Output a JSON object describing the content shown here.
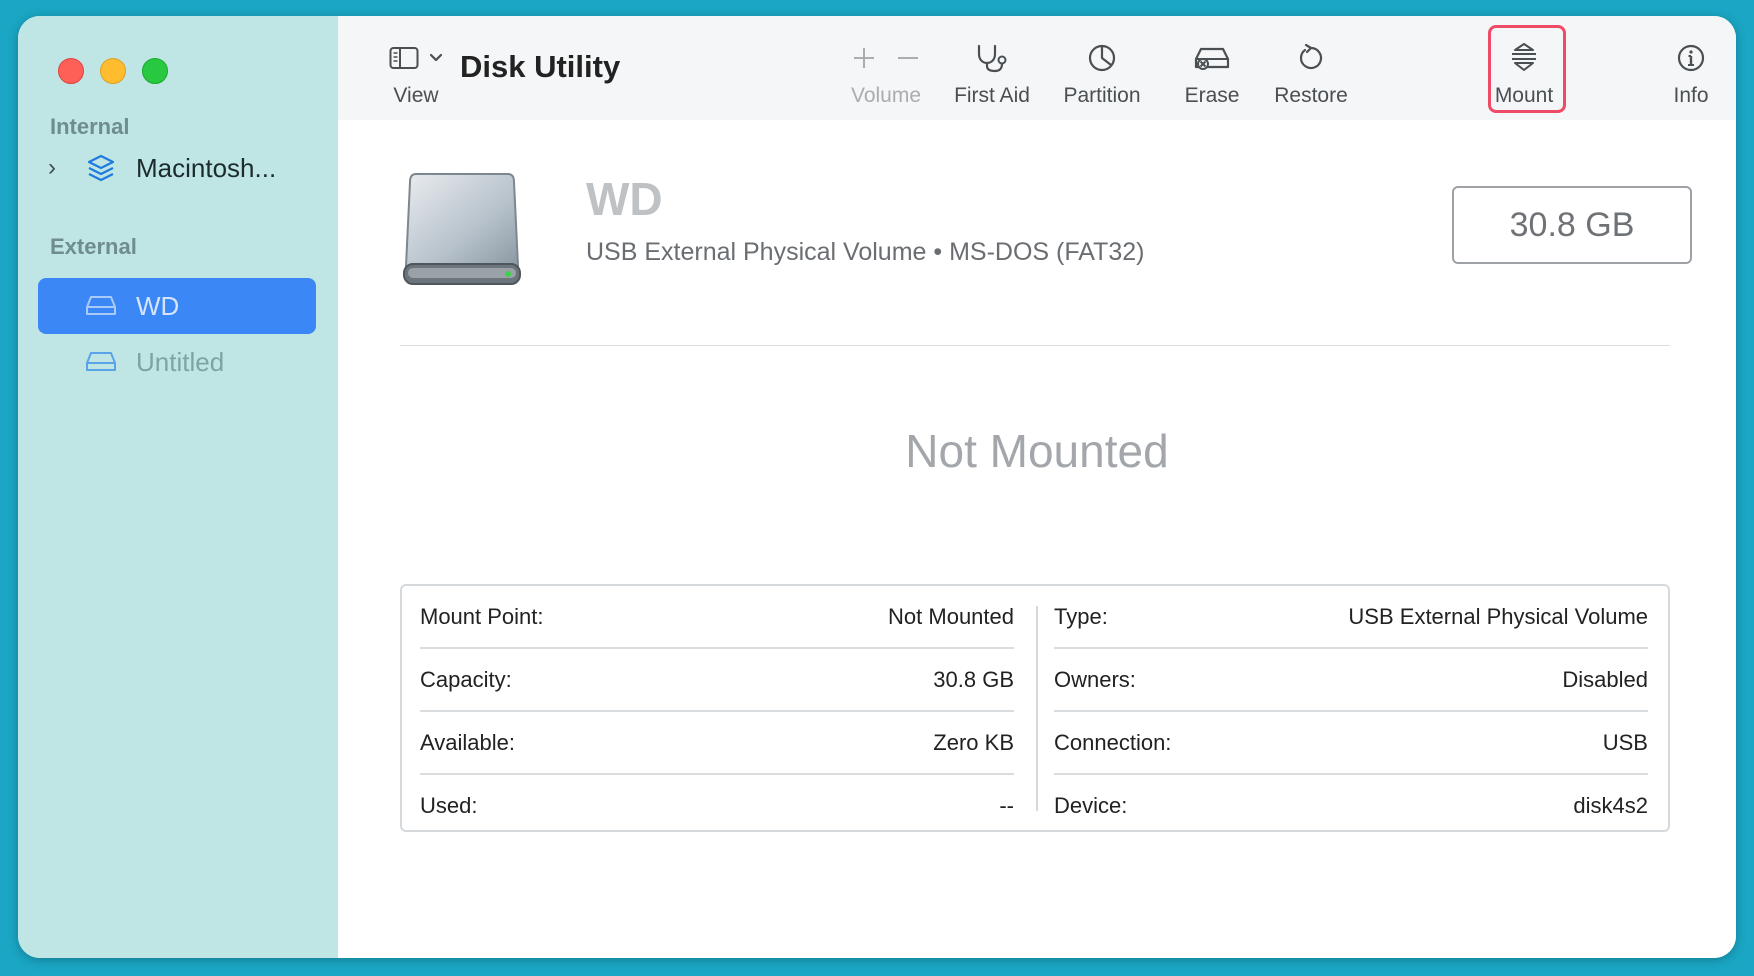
{
  "window": {
    "title": "Disk Utility"
  },
  "sidebar": {
    "sections": [
      {
        "label": "Internal",
        "items": [
          {
            "label": "Macintosh...",
            "icon": "layers-icon",
            "expandable": true
          }
        ]
      },
      {
        "label": "External",
        "items": [
          {
            "label": "WD",
            "icon": "drive-icon",
            "selected": true
          },
          {
            "label": "Untitled",
            "icon": "drive-icon",
            "selected": false
          }
        ]
      }
    ]
  },
  "toolbar": {
    "view_label": "View",
    "items": [
      {
        "label": "Volume",
        "icon": "plus-minus-icon",
        "enabled": false
      },
      {
        "label": "First Aid",
        "icon": "stethoscope-icon",
        "enabled": true
      },
      {
        "label": "Partition",
        "icon": "pie-chart-icon",
        "enabled": true
      },
      {
        "label": "Erase",
        "icon": "erase-drive-icon",
        "enabled": true
      },
      {
        "label": "Restore",
        "icon": "restore-icon",
        "enabled": true
      },
      {
        "label": "Mount",
        "icon": "mount-icon",
        "enabled": true,
        "highlighted": true
      },
      {
        "label": "Info",
        "icon": "info-icon",
        "enabled": true
      }
    ]
  },
  "disk": {
    "name": "WD",
    "subtitle": "USB External Physical Volume • MS-DOS (FAT32)",
    "size": "30.8 GB",
    "status": "Not Mounted"
  },
  "details": {
    "left": [
      {
        "key": "Mount Point:",
        "value": "Not Mounted"
      },
      {
        "key": "Capacity:",
        "value": "30.8 GB"
      },
      {
        "key": "Available:",
        "value": "Zero KB"
      },
      {
        "key": "Used:",
        "value": "--"
      }
    ],
    "right": [
      {
        "key": "Type:",
        "value": "USB External Physical Volume"
      },
      {
        "key": "Owners:",
        "value": "Disabled"
      },
      {
        "key": "Connection:",
        "value": "USB"
      },
      {
        "key": "Device:",
        "value": "disk4s2"
      }
    ]
  },
  "colors": {
    "sidebar_bg": "#bfe6e5",
    "selection": "#3a87f5",
    "highlight": "#ef4b66",
    "desktop": "#1aa6c4"
  }
}
